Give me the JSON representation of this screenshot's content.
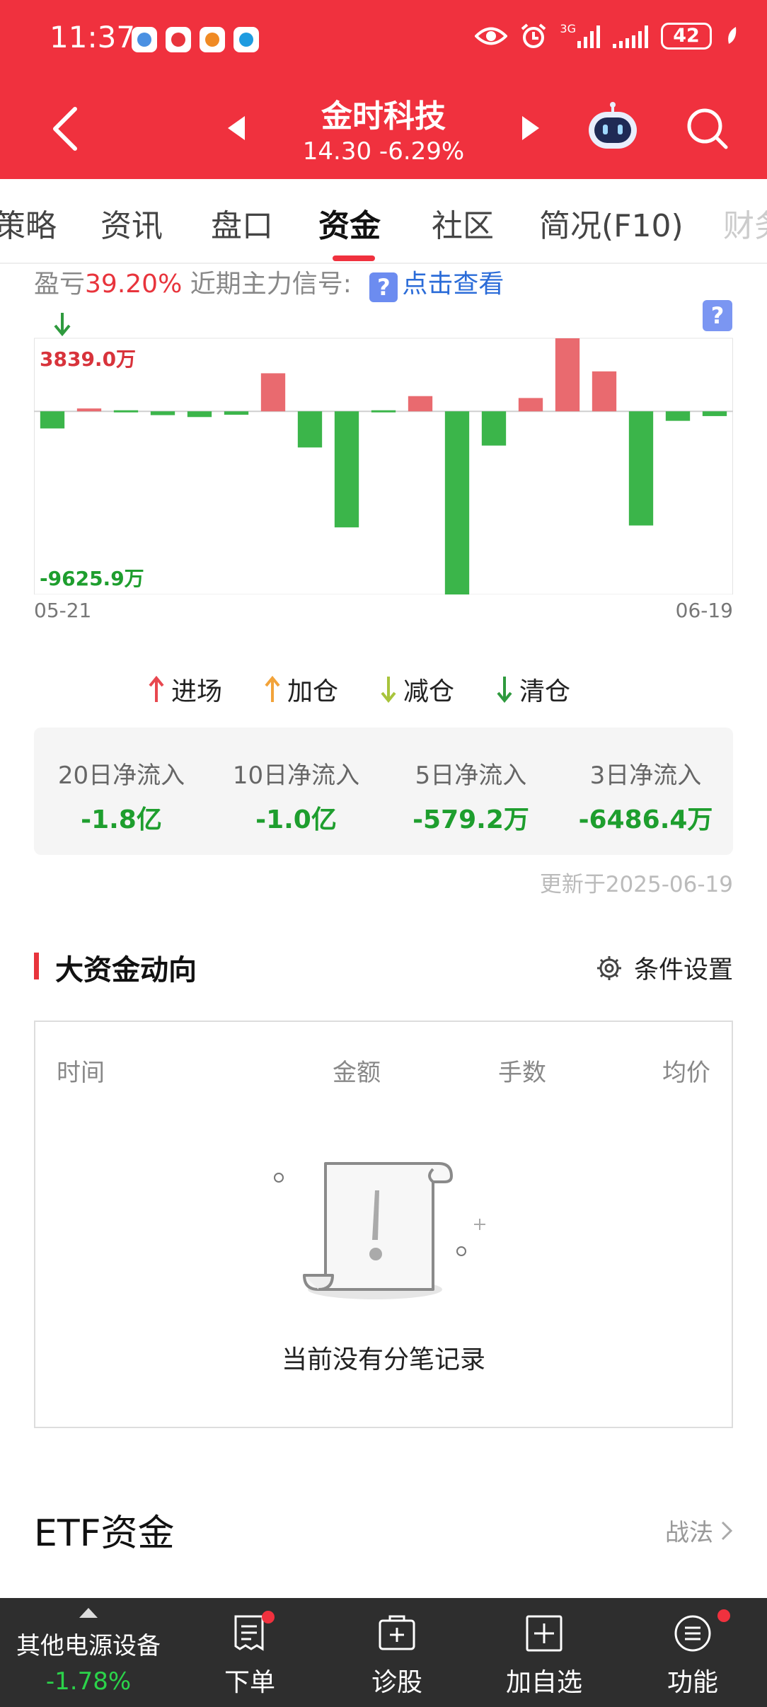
{
  "status": {
    "time": "11:37",
    "battery": "42",
    "network": "3G"
  },
  "header": {
    "stock_name": "金时科技",
    "quote": "14.30 -6.29%"
  },
  "tabs": [
    {
      "label": "策略"
    },
    {
      "label": "资讯"
    },
    {
      "label": "盘口"
    },
    {
      "label": "资金",
      "active": true
    },
    {
      "label": "社区"
    },
    {
      "label": "简况(F10)"
    },
    {
      "label": "财务"
    }
  ],
  "signal": {
    "prefix": "盈亏",
    "profit": "39.20%",
    "middle": "近期主力信号:",
    "help": "?",
    "link": "点击查看"
  },
  "chart_data": {
    "type": "bar",
    "title": "",
    "max_label": "3839.0万",
    "min_label": "-9625.9万",
    "x_start": "05-21",
    "x_end": "06-19",
    "unit": "万",
    "ylim": [
      -9625.9,
      3839.0
    ],
    "values": [
      -900,
      150,
      -60,
      -200,
      -300,
      -180,
      2000,
      -1900,
      -6100,
      -80,
      800,
      -9625.9,
      -1800,
      700,
      3839.0,
      2100,
      -6000,
      -500,
      -250
    ],
    "colors": {
      "up": "#e96a6f",
      "down": "#3bb54a"
    }
  },
  "legend": [
    {
      "label": "进场",
      "icon": "up-arrow-red",
      "color": "#e8474f",
      "dir": "up"
    },
    {
      "label": "加仓",
      "icon": "up-arrow-orange",
      "color": "#f2a33a",
      "dir": "up"
    },
    {
      "label": "减仓",
      "icon": "down-arrow-lightgreen",
      "color": "#a8c43c",
      "dir": "down"
    },
    {
      "label": "清仓",
      "icon": "down-arrow-green",
      "color": "#2f9a3e",
      "dir": "down"
    }
  ],
  "flows": [
    {
      "label": "20日净流入",
      "value": "-1.8亿"
    },
    {
      "label": "10日净流入",
      "value": "-1.0亿"
    },
    {
      "label": "5日净流入",
      "value": "-579.2万"
    },
    {
      "label": "3日净流入",
      "value": "-6486.4万"
    }
  ],
  "updated": "更新于2025-06-19",
  "big_money": {
    "title": "大资金动向",
    "settings": "条件设置",
    "columns": [
      "时间",
      "金额",
      "手数",
      "均价"
    ],
    "empty_text": "当前没有分笔记录"
  },
  "etf": {
    "title": "ETF资金",
    "link": "战法"
  },
  "bottom": {
    "sector_name": "其他电源设备",
    "sector_pct": "-1.78%",
    "buttons": [
      {
        "label": "下单",
        "icon": "order-icon"
      },
      {
        "label": "诊股",
        "icon": "diagnose-icon"
      },
      {
        "label": "加自选",
        "icon": "add-watchlist-icon"
      },
      {
        "label": "功能",
        "icon": "menu-icon"
      }
    ]
  }
}
